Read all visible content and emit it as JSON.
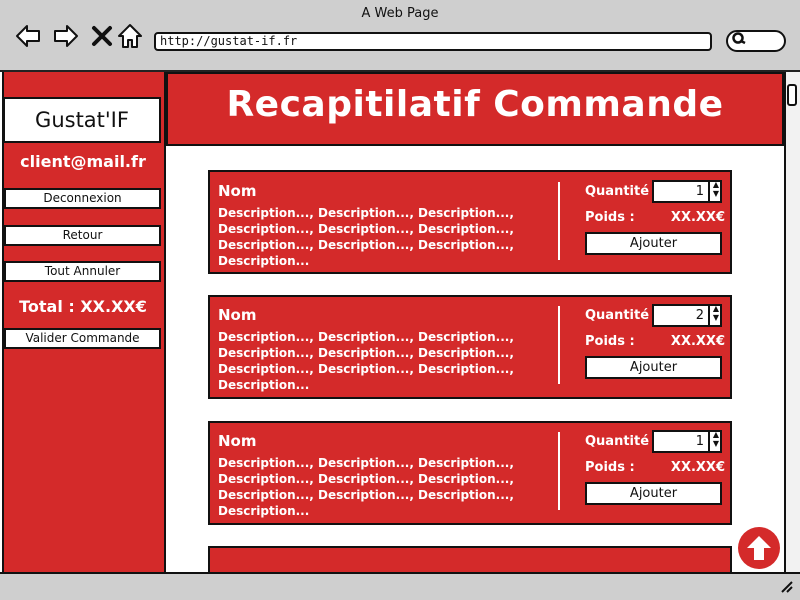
{
  "window": {
    "title": "A Web Page"
  },
  "browser": {
    "url": "http://gustat-if.fr",
    "icons": [
      "back-arrow-icon",
      "forward-arrow-icon",
      "close-icon",
      "home-icon",
      "search-icon"
    ]
  },
  "sidebar": {
    "brand": "Gustat'IF",
    "email": "client@mail.fr",
    "logout_label": "Deconnexion",
    "back_label": "Retour",
    "cancel_all_label": "Tout Annuler",
    "total_label": "Total : XX.XX€",
    "validate_label": "Valider Commande"
  },
  "main": {
    "title": "Recapitilatif Commande"
  },
  "products": [
    {
      "name": "Nom",
      "description": "Description..., Description..., Description..., Description..., Description..., Description..., Description..., Description..., Description..., Description...",
      "quantity_label": "Quantité :",
      "quantity": "1",
      "weight_label": "Poids :",
      "weight": "XX.XX€",
      "add_label": "Ajouter"
    },
    {
      "name": "Nom",
      "description": "Description..., Description..., Description..., Description..., Description..., Description..., Description..., Description..., Description..., Description...",
      "quantity_label": "Quantité :",
      "quantity": "2",
      "weight_label": "Poids :",
      "weight": "XX.XX€",
      "add_label": "Ajouter"
    },
    {
      "name": "Nom",
      "description": "Description..., Description..., Description..., Description..., Description..., Description..., Description..., Description..., Description..., Description...",
      "quantity_label": "Quantité :",
      "quantity": "1",
      "weight_label": "Poids :",
      "weight": "XX.XX€",
      "add_label": "Ajouter"
    }
  ],
  "colors": {
    "accent": "#d42a2a",
    "chrome": "#cfcfcf"
  }
}
